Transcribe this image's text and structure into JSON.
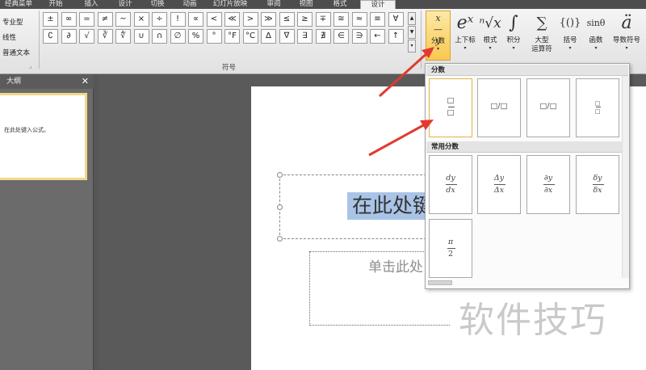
{
  "tabs": [
    "经典菜单",
    "开始",
    "插入",
    "设计",
    "切换",
    "动画",
    "幻灯片放映",
    "审阅",
    "视图",
    "格式",
    "设计"
  ],
  "ribbon": {
    "conversions": [
      "专业型",
      "线性",
      "普通文本"
    ],
    "symbol_group_label": "符号",
    "symbols_row1": [
      "±",
      "∞",
      "=",
      "≠",
      "~",
      "×",
      "÷",
      "!",
      "∝",
      "<",
      "≪",
      ">",
      "≫",
      "≤",
      "≥",
      "∓",
      "≅",
      "≈",
      "≡",
      "∀"
    ],
    "symbols_row2": [
      "∁",
      "∂",
      "√",
      "∛",
      "∜",
      "∪",
      "∩",
      "∅",
      "%",
      "°",
      "°F",
      "°C",
      "∆",
      "∇",
      "∃",
      "∄",
      "∈",
      "∋",
      "←",
      "↑"
    ],
    "structures": [
      {
        "glyph": "x/y",
        "label": "分数"
      },
      {
        "glyph": "eˣ",
        "label": "上下标"
      },
      {
        "glyph": "ⁿ√x",
        "label": "根式"
      },
      {
        "glyph": "∫",
        "label": "积分"
      },
      {
        "glyph": "∑",
        "label": "大型",
        "label2": "运算符"
      },
      {
        "glyph": "{()}",
        "label": "括号"
      },
      {
        "glyph": "sinθ",
        "label": "函数"
      },
      {
        "glyph": "ä",
        "label": "导数符号"
      }
    ]
  },
  "outline": {
    "title": "大纲",
    "close": "✕",
    "thumb_text": "在此处键入公式。"
  },
  "slide": {
    "equation_text": "在此处键",
    "subtitle_text": "单击此处"
  },
  "dropdown": {
    "section1": "分数",
    "section2": "常用分数",
    "tiles1": [
      {
        "num": "□",
        "den": "□",
        "style": "stacked"
      },
      {
        "text": "□/□",
        "style": "skewed"
      },
      {
        "text": "□/□",
        "style": "linear"
      },
      {
        "num": "□",
        "den": "□",
        "style": "small"
      }
    ],
    "tiles2": [
      {
        "num": "dy",
        "den": "dx"
      },
      {
        "num": "Δy",
        "den": "Δx"
      },
      {
        "num": "∂y",
        "den": "∂x"
      },
      {
        "num": "δy",
        "den": "δx"
      },
      {
        "num": "π",
        "den": "2"
      }
    ]
  },
  "watermark": "软件技巧",
  "colors": {
    "accent_orange": "#f9c84f",
    "selection_blue": "#a9c4e6",
    "arrow_red": "#e03a30"
  }
}
